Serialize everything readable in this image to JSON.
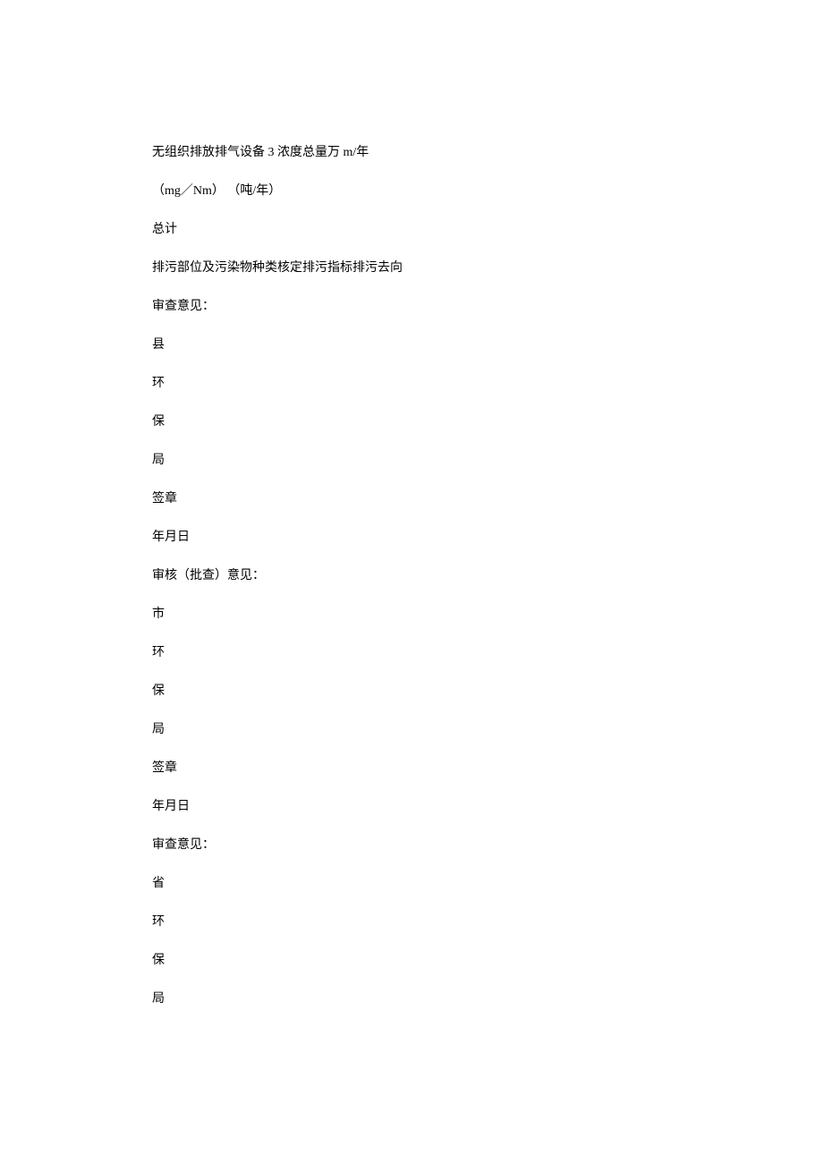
{
  "lines": [
    "无组织排放排气设备 3 浓度总量万 m/年",
    "（mg／Nm） （吨/年）",
    "总计",
    "排污部位及污染物种类核定排污指标排污去向",
    "审查意见：",
    "县",
    "环",
    "保",
    "局",
    "签章",
    "年月日",
    "审核（批查）意见：",
    "市",
    "环",
    "保",
    "局",
    "签章",
    "年月日",
    "审查意见：",
    "省",
    "环",
    "保",
    "局"
  ]
}
